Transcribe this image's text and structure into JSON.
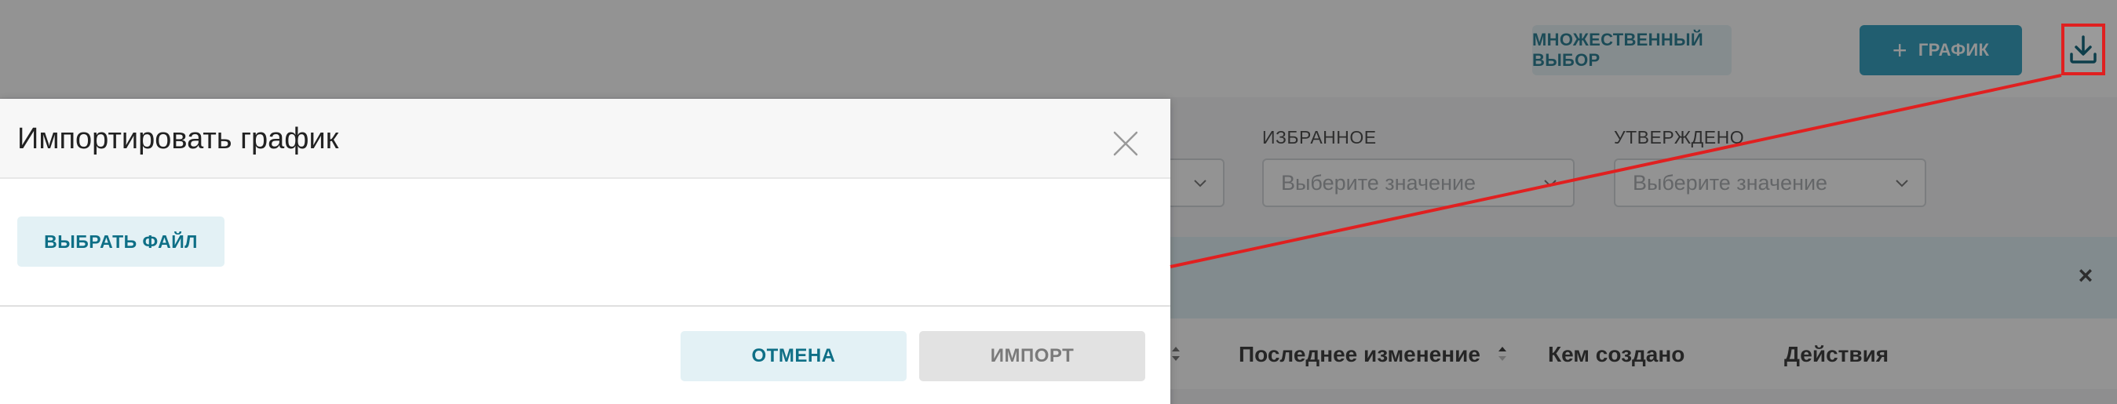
{
  "toolbar": {
    "multi_select_label": "МНОЖЕСТВЕННЫЙ ВЫБОР",
    "add_chart_label": "ГРАФИК",
    "download_icon": "download-icon"
  },
  "filters": {
    "favorites": {
      "label": "ИЗБРАННОЕ",
      "placeholder": "Выберите значение"
    },
    "approved": {
      "label": "УТВЕРЖДЕНО",
      "placeholder": "Выберите значение"
    }
  },
  "table": {
    "columns": [
      "Последнее изменение",
      "Кем создано",
      "Действия"
    ]
  },
  "modal": {
    "title": "Импортировать график",
    "choose_file_label": "ВЫБРАТЬ ФАЙЛ",
    "cancel_label": "ОТМЕНА",
    "import_label": "ИМПОРТ"
  },
  "colors": {
    "accent": "#1a95b8",
    "annotation": "#e02020"
  }
}
